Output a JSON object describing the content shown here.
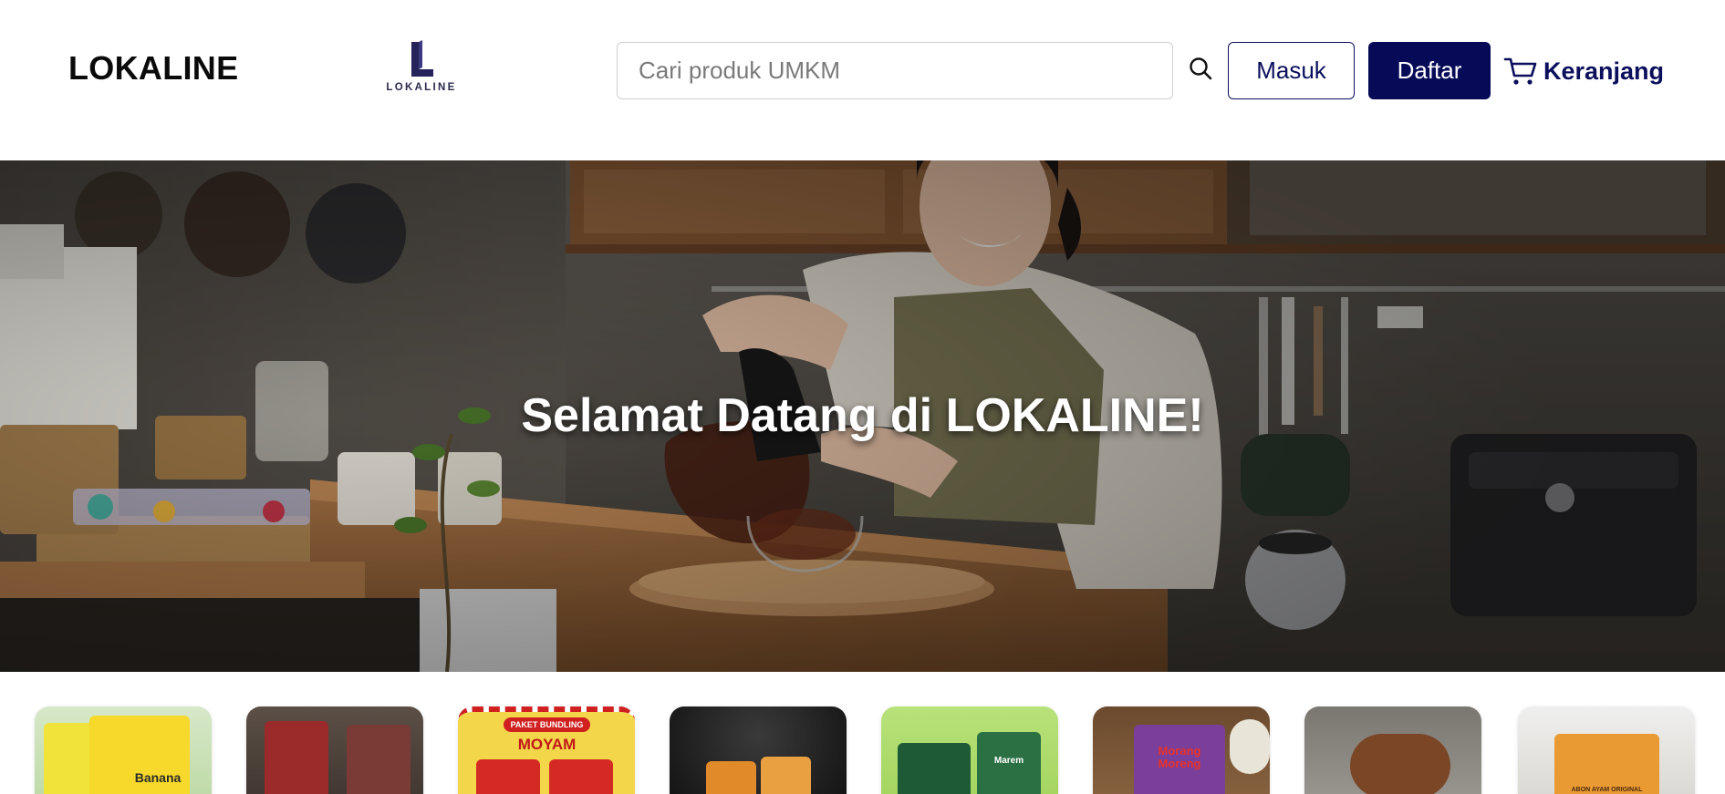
{
  "header": {
    "brand_name": "LOKALINE",
    "logo_wordmark": "LOKALINE",
    "search_placeholder": "Cari produk UMKM",
    "search_icon": "search-icon",
    "login_label": "Masuk",
    "register_label": "Daftar",
    "cart_label": "Keranjang",
    "cart_icon": "cart-icon"
  },
  "hero": {
    "title": "Selamat Datang di LOKALINE!"
  },
  "products": {
    "items": [
      {
        "name": "product-snack-banana",
        "label": "Banana"
      },
      {
        "name": "product-batik-clothing",
        "label": ""
      },
      {
        "name": "product-moyam-bundle",
        "label": "PAKET BUNDLING",
        "sub": "MOYAM"
      },
      {
        "name": "product-snack-pouch",
        "label": ""
      },
      {
        "name": "product-marem-pack",
        "label": "Marem"
      },
      {
        "name": "product-morang-moreng",
        "label": "Morang Moreng"
      },
      {
        "name": "product-wooden-bowl",
        "label": ""
      },
      {
        "name": "product-abon-ayam",
        "label": "ABON AYAM ORIGINAL"
      }
    ]
  },
  "colors": {
    "primary": "#060a57",
    "primary_outline": "#0b0f5c",
    "header_bg": "#ffffff",
    "hero_text": "#ffffff"
  }
}
